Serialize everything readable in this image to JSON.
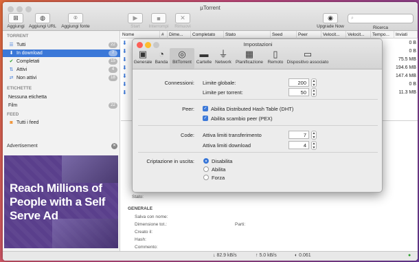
{
  "window": {
    "title": "µTorrent"
  },
  "toolbar": {
    "add": "Aggiungi",
    "add_url": "Aggiungi URL",
    "add_feed": "Aggiungi fonte",
    "start": "Start",
    "stop": "Interrompi",
    "remove": "Rimuovi",
    "upgrade": "Upgrade Now",
    "search": "Ricerca"
  },
  "sidebar": {
    "torrent_header": "TORRENT",
    "items": [
      {
        "label": "Tutti",
        "count": "22",
        "icon": "list-icon"
      },
      {
        "label": "In download",
        "count": "7",
        "icon": "download-icon"
      },
      {
        "label": "Completati",
        "count": "15",
        "icon": "check-icon"
      },
      {
        "label": "Attivi",
        "count": "4",
        "icon": "updown-icon"
      },
      {
        "label": "Non attivi",
        "count": "18",
        "icon": "inactive-icon"
      }
    ],
    "labels_header": "ETICHETTE",
    "labels": [
      {
        "label": "Nessuna etichetta",
        "count": ""
      },
      {
        "label": "Film",
        "count": "22"
      }
    ],
    "feed_header": "FEED",
    "feeds": [
      {
        "label": "Tutti i feed"
      }
    ],
    "ad_label": "Advertisement",
    "ad_text": "Reach Millions of People with a Self Serve Ad"
  },
  "table": {
    "columns": [
      "Nome",
      "#",
      "Dime...",
      "Completato",
      "Stato",
      "Seed",
      "Peer",
      "Velocit...",
      "Velocit...",
      "Tempo...",
      "Inviati"
    ],
    "right_values": [
      "0 B",
      "0 B",
      "75.5 MB",
      "194.6 MB",
      "147.4 MB",
      "0 B",
      "11.3 MB"
    ]
  },
  "details": {
    "state_label": "Stato:",
    "general_header": "GENERALE",
    "save_as": "Salva con nome:",
    "total_size": "Dimensione tot.:",
    "pieces": "Parti:",
    "created": "Creato il:",
    "hash": "Hash:",
    "comment": "Commento:"
  },
  "status_bar": {
    "down": "↓ 82.9 kB/s",
    "up": "↑ 5.0 kB/s",
    "ratio": "◐ 0.061"
  },
  "dialog": {
    "title": "Impostazioni",
    "tabs": [
      {
        "label": "Generale",
        "icon": "general-icon"
      },
      {
        "label": "Banda",
        "icon": "gauge-icon"
      },
      {
        "label": "BitTorrent",
        "icon": "bittorrent-icon",
        "selected": true
      },
      {
        "label": "Cartelle",
        "icon": "folder-icon"
      },
      {
        "label": "Network",
        "icon": "plug-icon"
      },
      {
        "label": "Planificazione",
        "icon": "calendar-icon"
      },
      {
        "label": "Remoto",
        "icon": "phone-icon"
      },
      {
        "label": "Dispositivo associato",
        "icon": "monitor-icon"
      }
    ],
    "connections_label": "Connessioni:",
    "global_limit_label": "Limite globale:",
    "global_limit_value": "200",
    "per_torrent_label": "Limite per torrent:",
    "per_torrent_value": "50",
    "peer_label": "Peer:",
    "dht_label": "Abilita Distributed Hash Table (DHT)",
    "dht_checked": true,
    "pex_label": "Abilita scambio peer (PEX)",
    "pex_checked": true,
    "queue_label": "Code:",
    "active_transfers_label": "Attiva limiti transferimento",
    "active_transfers_value": "7",
    "active_downloads_label": "Attiva limiti download",
    "active_downloads_value": "4",
    "encryption_label": "Criptazione in uscita:",
    "encryption_options": [
      "Disabilita",
      "Abilita",
      "Forza"
    ],
    "encryption_selected": "Disabilita"
  }
}
